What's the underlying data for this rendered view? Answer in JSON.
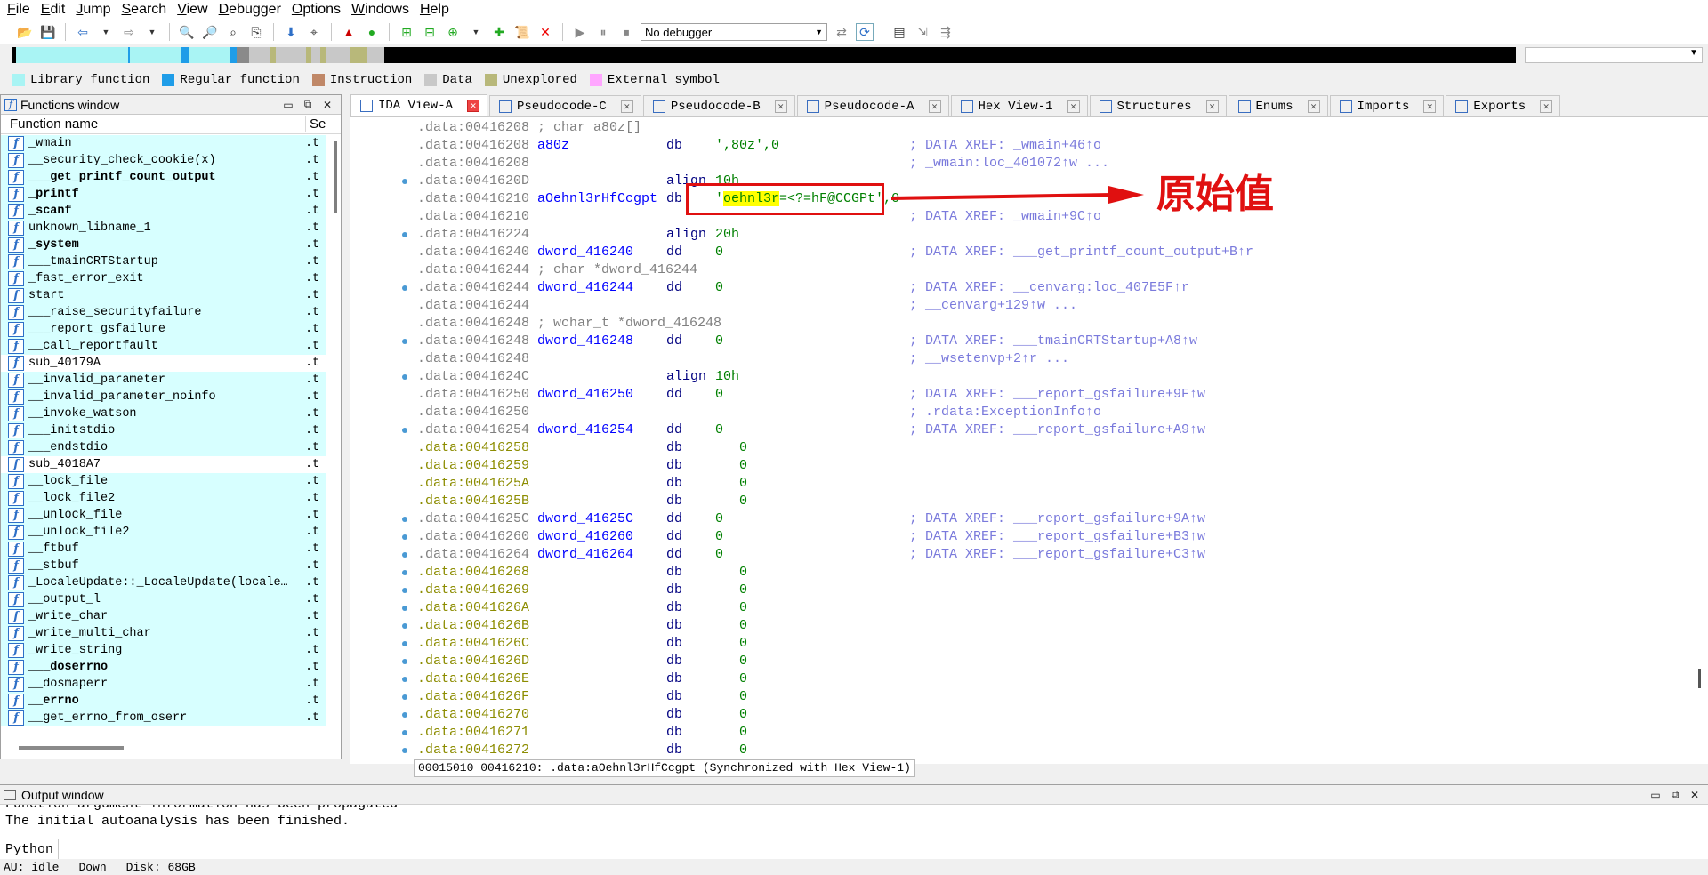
{
  "menu": [
    "File",
    "Edit",
    "Jump",
    "Search",
    "View",
    "Debugger",
    "Options",
    "Windows",
    "Help"
  ],
  "toolbar": {
    "debugger_value": "No debugger"
  },
  "legend": [
    {
      "label": "Library function",
      "color": "#a9f4f4"
    },
    {
      "label": "Regular function",
      "color": "#1f9de8"
    },
    {
      "label": "Instruction",
      "color": "#c08868"
    },
    {
      "label": "Data",
      "color": "#c8c8c8"
    },
    {
      "label": "Unexplored",
      "color": "#b8b87a"
    },
    {
      "label": "External symbol",
      "color": "#ffa6ff"
    }
  ],
  "functions_window": {
    "title": "Functions window",
    "col_name": "Function name",
    "col_seg": "Se",
    "rows": [
      {
        "name": "_wmain",
        "seg": ".t",
        "lib": true,
        "bold": false
      },
      {
        "name": "__security_check_cookie(x)",
        "seg": ".t",
        "lib": true,
        "bold": false
      },
      {
        "name": "___get_printf_count_output",
        "seg": ".t",
        "lib": true,
        "bold": true
      },
      {
        "name": "_printf",
        "seg": ".t",
        "lib": true,
        "bold": true
      },
      {
        "name": "_scanf",
        "seg": ".t",
        "lib": true,
        "bold": true
      },
      {
        "name": "unknown_libname_1",
        "seg": ".t",
        "lib": true,
        "bold": false
      },
      {
        "name": "_system",
        "seg": ".t",
        "lib": true,
        "bold": true
      },
      {
        "name": "___tmainCRTStartup",
        "seg": ".t",
        "lib": true,
        "bold": false
      },
      {
        "name": "_fast_error_exit",
        "seg": ".t",
        "lib": true,
        "bold": false
      },
      {
        "name": "start",
        "seg": ".t",
        "lib": true,
        "bold": false
      },
      {
        "name": "___raise_securityfailure",
        "seg": ".t",
        "lib": true,
        "bold": false
      },
      {
        "name": "___report_gsfailure",
        "seg": ".t",
        "lib": true,
        "bold": false
      },
      {
        "name": "__call_reportfault",
        "seg": ".t",
        "lib": true,
        "bold": false
      },
      {
        "name": "sub_40179A",
        "seg": ".t",
        "lib": false,
        "bold": false
      },
      {
        "name": "__invalid_parameter",
        "seg": ".t",
        "lib": true,
        "bold": false
      },
      {
        "name": "__invalid_parameter_noinfo",
        "seg": ".t",
        "lib": true,
        "bold": false
      },
      {
        "name": "__invoke_watson",
        "seg": ".t",
        "lib": true,
        "bold": false
      },
      {
        "name": "___initstdio",
        "seg": ".t",
        "lib": true,
        "bold": false
      },
      {
        "name": "___endstdio",
        "seg": ".t",
        "lib": true,
        "bold": false
      },
      {
        "name": "sub_4018A7",
        "seg": ".t",
        "lib": false,
        "bold": false
      },
      {
        "name": "__lock_file",
        "seg": ".t",
        "lib": true,
        "bold": false
      },
      {
        "name": "__lock_file2",
        "seg": ".t",
        "lib": true,
        "bold": false
      },
      {
        "name": "__unlock_file",
        "seg": ".t",
        "lib": true,
        "bold": false
      },
      {
        "name": "__unlock_file2",
        "seg": ".t",
        "lib": true,
        "bold": false
      },
      {
        "name": "__ftbuf",
        "seg": ".t",
        "lib": true,
        "bold": false
      },
      {
        "name": "__stbuf",
        "seg": ".t",
        "lib": true,
        "bold": false
      },
      {
        "name": "_LocaleUpdate::_LocaleUpdate(locale…",
        "seg": ".t",
        "lib": true,
        "bold": false
      },
      {
        "name": "__output_l",
        "seg": ".t",
        "lib": true,
        "bold": false
      },
      {
        "name": "_write_char",
        "seg": ".t",
        "lib": true,
        "bold": false
      },
      {
        "name": "_write_multi_char",
        "seg": ".t",
        "lib": true,
        "bold": false
      },
      {
        "name": "_write_string",
        "seg": ".t",
        "lib": true,
        "bold": false
      },
      {
        "name": "___doserrno",
        "seg": ".t",
        "lib": true,
        "bold": true
      },
      {
        "name": "__dosmaperr",
        "seg": ".t",
        "lib": true,
        "bold": false
      },
      {
        "name": "__errno",
        "seg": ".t",
        "lib": true,
        "bold": true
      },
      {
        "name": "__get_errno_from_oserr",
        "seg": ".t",
        "lib": true,
        "bold": false
      }
    ]
  },
  "tabs": [
    {
      "label": "IDA View-A",
      "active": true,
      "icon": "ida-view-icon"
    },
    {
      "label": "Pseudocode-C",
      "active": false,
      "icon": "pseudocode-icon"
    },
    {
      "label": "Pseudocode-B",
      "active": false,
      "icon": "pseudocode-icon"
    },
    {
      "label": "Pseudocode-A",
      "active": false,
      "icon": "pseudocode-icon"
    },
    {
      "label": "Hex View-1",
      "active": false,
      "icon": "hex-view-icon"
    },
    {
      "label": "Structures",
      "active": false,
      "icon": "structures-icon"
    },
    {
      "label": "Enums",
      "active": false,
      "icon": "enums-icon"
    },
    {
      "label": "Imports",
      "active": false,
      "icon": "imports-icon"
    },
    {
      "label": "Exports",
      "active": false,
      "icon": "exports-icon"
    }
  ],
  "disasm": {
    "lines": [
      {
        "addr": ".data:00416208",
        "addr_olive": false,
        "label": "",
        "mnem": "",
        "operand": "",
        "xref": "",
        "comment": "; char a80z[]",
        "dot": false
      },
      {
        "addr": ".data:00416208",
        "addr_olive": false,
        "label": "a80z",
        "mnem": "db",
        "operand": "',80z',0",
        "xref": "; DATA XREF: _wmain+46↑o",
        "comment": "",
        "dot": false
      },
      {
        "addr": ".data:00416208",
        "addr_olive": false,
        "label": "",
        "mnem": "",
        "operand": "",
        "xref": "; _wmain:loc_401072↑w ...",
        "comment": "",
        "dot": false
      },
      {
        "addr": ".data:0041620D",
        "addr_olive": false,
        "label": "",
        "mnem": "align",
        "operand": "10h",
        "xref": "",
        "comment": "",
        "dot": true
      },
      {
        "addr": ".data:00416210",
        "addr_olive": false,
        "label": "aOehnl3rHfCcgpt",
        "mnem": "db",
        "operand": "",
        "xref": "",
        "comment": "",
        "dot": false,
        "special": true
      },
      {
        "addr": ".data:00416210",
        "addr_olive": false,
        "label": "",
        "mnem": "",
        "operand": "",
        "xref": "; DATA XREF: _wmain+9C↑o",
        "comment": "",
        "dot": false
      },
      {
        "addr": ".data:00416224",
        "addr_olive": false,
        "label": "",
        "mnem": "align",
        "operand": "20h",
        "xref": "",
        "comment": "",
        "dot": true
      },
      {
        "addr": ".data:00416240",
        "addr_olive": false,
        "label": "dword_416240",
        "mnem": "dd",
        "operand": "0",
        "xref": "; DATA XREF: ___get_printf_count_output+B↑r",
        "comment": "",
        "dot": false
      },
      {
        "addr": ".data:00416244",
        "addr_olive": false,
        "label": "",
        "mnem": "",
        "operand": "",
        "xref": "",
        "comment": "; char *dword_416244",
        "dot": false
      },
      {
        "addr": ".data:00416244",
        "addr_olive": false,
        "label": "dword_416244",
        "mnem": "dd",
        "operand": "0",
        "xref": "; DATA XREF: __cenvarg:loc_407E5F↑r",
        "comment": "",
        "dot": true
      },
      {
        "addr": ".data:00416244",
        "addr_olive": false,
        "label": "",
        "mnem": "",
        "operand": "",
        "xref": "; __cenvarg+129↑w ...",
        "comment": "",
        "dot": false
      },
      {
        "addr": ".data:00416248",
        "addr_olive": false,
        "label": "",
        "mnem": "",
        "operand": "",
        "xref": "",
        "comment": "; wchar_t *dword_416248",
        "dot": false
      },
      {
        "addr": ".data:00416248",
        "addr_olive": false,
        "label": "dword_416248",
        "mnem": "dd",
        "operand": "0",
        "xref": "; DATA XREF: ___tmainCRTStartup+A8↑w",
        "comment": "",
        "dot": true
      },
      {
        "addr": ".data:00416248",
        "addr_olive": false,
        "label": "",
        "mnem": "",
        "operand": "",
        "xref": "; __wsetenvp+2↑r ...",
        "comment": "",
        "dot": false
      },
      {
        "addr": ".data:0041624C",
        "addr_olive": false,
        "label": "",
        "mnem": "align",
        "operand": "10h",
        "xref": "",
        "comment": "",
        "dot": true
      },
      {
        "addr": ".data:00416250",
        "addr_olive": false,
        "label": "dword_416250",
        "mnem": "dd",
        "operand": "0",
        "xref": "; DATA XREF: ___report_gsfailure+9F↑w",
        "comment": "",
        "dot": false
      },
      {
        "addr": ".data:00416250",
        "addr_olive": false,
        "label": "",
        "mnem": "",
        "operand": "",
        "xref": "; .rdata:ExceptionInfo↑o",
        "comment": "",
        "dot": false
      },
      {
        "addr": ".data:00416254",
        "addr_olive": false,
        "label": "dword_416254",
        "mnem": "dd",
        "operand": "0",
        "xref": "; DATA XREF: ___report_gsfailure+A9↑w",
        "comment": "",
        "dot": true
      },
      {
        "addr": ".data:00416258",
        "addr_olive": true,
        "label": "",
        "mnem": "db",
        "operand": "   0",
        "xref": "",
        "comment": "",
        "dot": false
      },
      {
        "addr": ".data:00416259",
        "addr_olive": true,
        "label": "",
        "mnem": "db",
        "operand": "   0",
        "xref": "",
        "comment": "",
        "dot": false
      },
      {
        "addr": ".data:0041625A",
        "addr_olive": true,
        "label": "",
        "mnem": "db",
        "operand": "   0",
        "xref": "",
        "comment": "",
        "dot": false
      },
      {
        "addr": ".data:0041625B",
        "addr_olive": true,
        "label": "",
        "mnem": "db",
        "operand": "   0",
        "xref": "",
        "comment": "",
        "dot": false
      },
      {
        "addr": ".data:0041625C",
        "addr_olive": false,
        "label": "dword_41625C",
        "mnem": "dd",
        "operand": "0",
        "xref": "; DATA XREF: ___report_gsfailure+9A↑w",
        "comment": "",
        "dot": true
      },
      {
        "addr": ".data:00416260",
        "addr_olive": false,
        "label": "dword_416260",
        "mnem": "dd",
        "operand": "0",
        "xref": "; DATA XREF: ___report_gsfailure+B3↑w",
        "comment": "",
        "dot": true
      },
      {
        "addr": ".data:00416264",
        "addr_olive": false,
        "label": "dword_416264",
        "mnem": "dd",
        "operand": "0",
        "xref": "; DATA XREF: ___report_gsfailure+C3↑w",
        "comment": "",
        "dot": true
      },
      {
        "addr": ".data:00416268",
        "addr_olive": true,
        "label": "",
        "mnem": "db",
        "operand": "   0",
        "xref": "",
        "comment": "",
        "dot": true
      },
      {
        "addr": ".data:00416269",
        "addr_olive": true,
        "label": "",
        "mnem": "db",
        "operand": "   0",
        "xref": "",
        "comment": "",
        "dot": true
      },
      {
        "addr": ".data:0041626A",
        "addr_olive": true,
        "label": "",
        "mnem": "db",
        "operand": "   0",
        "xref": "",
        "comment": "",
        "dot": true
      },
      {
        "addr": ".data:0041626B",
        "addr_olive": true,
        "label": "",
        "mnem": "db",
        "operand": "   0",
        "xref": "",
        "comment": "",
        "dot": true
      },
      {
        "addr": ".data:0041626C",
        "addr_olive": true,
        "label": "",
        "mnem": "db",
        "operand": "   0",
        "xref": "",
        "comment": "",
        "dot": true
      },
      {
        "addr": ".data:0041626D",
        "addr_olive": true,
        "label": "",
        "mnem": "db",
        "operand": "   0",
        "xref": "",
        "comment": "",
        "dot": true
      },
      {
        "addr": ".data:0041626E",
        "addr_olive": true,
        "label": "",
        "mnem": "db",
        "operand": "   0",
        "xref": "",
        "comment": "",
        "dot": true
      },
      {
        "addr": ".data:0041626F",
        "addr_olive": true,
        "label": "",
        "mnem": "db",
        "operand": "   0",
        "xref": "",
        "comment": "",
        "dot": true
      },
      {
        "addr": ".data:00416270",
        "addr_olive": true,
        "label": "",
        "mnem": "db",
        "operand": "   0",
        "xref": "",
        "comment": "",
        "dot": true
      },
      {
        "addr": ".data:00416271",
        "addr_olive": true,
        "label": "",
        "mnem": "db",
        "operand": "   0",
        "xref": "",
        "comment": "",
        "dot": true
      },
      {
        "addr": ".data:00416272",
        "addr_olive": true,
        "label": "",
        "mnem": "db",
        "operand": "   0",
        "xref": "",
        "comment": "",
        "dot": true
      }
    ],
    "string_line": {
      "quote_open": "'",
      "highlight": "oehnl3r",
      "rest": "=<?=hF@CCGPt'",
      "suffix": ",0"
    },
    "status": "00015010 00416210: .data:aOehnl3rHfCcgpt (Synchronized with Hex View-1)"
  },
  "annotation": {
    "text": "原始值",
    "color": "#e01010"
  },
  "output_window": {
    "title": "Output window",
    "line1": "Function argument information has been propagated",
    "line2": "The initial autoanalysis has been finished.",
    "python_label": "Python"
  },
  "statusbar": {
    "au": "AU:",
    "state": "idle",
    "direction": "Down",
    "disk": "Disk: 68GB"
  }
}
